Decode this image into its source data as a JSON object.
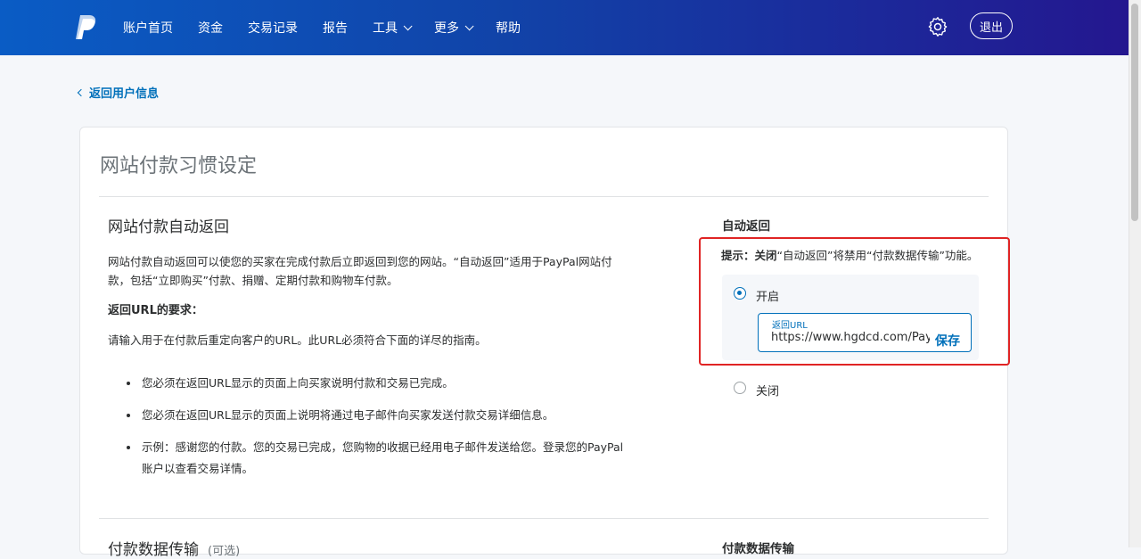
{
  "nav": {
    "items": [
      {
        "label": "账户首页",
        "dropdown": false
      },
      {
        "label": "资金",
        "dropdown": false
      },
      {
        "label": "交易记录",
        "dropdown": false
      },
      {
        "label": "报告",
        "dropdown": false
      },
      {
        "label": "工具",
        "dropdown": true
      },
      {
        "label": "更多",
        "dropdown": true
      },
      {
        "label": "帮助",
        "dropdown": false
      }
    ],
    "logout_label": "退出"
  },
  "back_link": "返回用户信息",
  "page_title": "网站付款习惯设定",
  "auto_return": {
    "section_title": "网站付款自动返回",
    "description": "网站付款自动返回可以使您的买家在完成付款后立即返回到您的网站。“自动返回”适用于PayPal网站付款，包括“立即购买”付款、捐赠、定期付款和购物车付款。",
    "requirements_title": "返回URL的要求：",
    "requirements_intro": "请输入用于在付款后重定向客户的URL。此URL必须符合下面的详尽的指南。",
    "bullets": [
      "您必须在返回URL显示的页面上向买家说明付款和交易已完成。",
      "您必须在返回URL显示的页面上说明将通过电子邮件向买家发送付款交易详细信息。",
      "示例：感谢您的付款。您的交易已完成，您购物的收据已经用电子邮件发送给您。登录您的PayPal账户以查看交易详情。"
    ],
    "right_title": "自动返回",
    "hint_prefix": "提示：关闭",
    "hint_rest": "“自动返回”将禁用“付款数据传输”功能。",
    "on_label": "开启",
    "off_label": "关闭",
    "url_label": "返回URL",
    "url_value": "https://www.hgdcd.com/PayPal",
    "save_label": "保存"
  },
  "pdt": {
    "section_title": "付款数据传输",
    "optional": "(可选)",
    "right_title": "付款数据传输"
  },
  "colors": {
    "accent": "#0070ba",
    "highlight_border": "#e02424"
  }
}
